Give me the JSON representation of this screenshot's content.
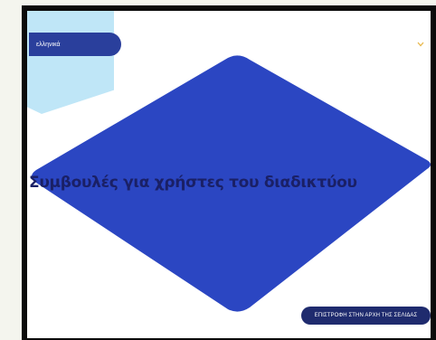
{
  "language_selector": {
    "label": "ελληνικά"
  },
  "icons": {
    "language_menu": "chevron-down-icon"
  },
  "hero": {
    "title": "Συμβουλές για χρήστες του διαδικτύου"
  },
  "footer": {
    "back_to_top_label": "ΕΠΙΣΤΡΟΦΗ ΣΤΗΝ ΑΡΧΗ ΤΗΣ ΣΕΛΙΔΑΣ"
  },
  "colors": {
    "accent": "#2b46c2",
    "dark_navy": "#1f2b6e",
    "light_blue": "#bfe6f7",
    "chevron": "#e8b84a",
    "title": "#1a2066"
  }
}
